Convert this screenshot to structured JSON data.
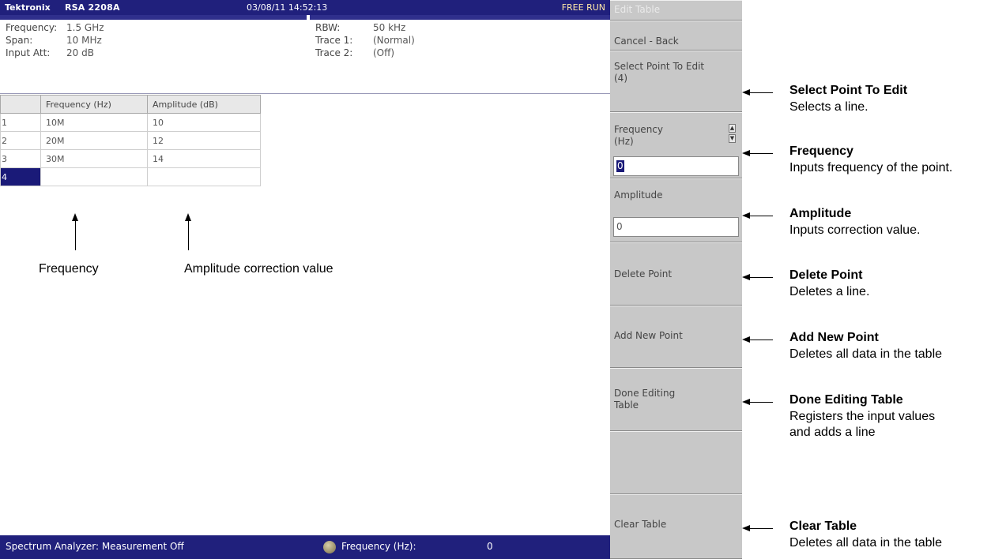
{
  "titlebar": {
    "brand": "Tektronix",
    "model": "RSA 2208A",
    "datetime": "03/08/11 14:52:13",
    "status": "FREE RUN"
  },
  "params": {
    "frequency_label": "Frequency:",
    "frequency_value": "1.5 GHz",
    "span_label": "Span:",
    "span_value": "10 MHz",
    "input_att_label": "Input Att:",
    "input_att_value": "20 dB",
    "rbw_label": "RBW:",
    "rbw_value": "50 kHz",
    "trace1_label": "Trace 1:",
    "trace1_value": "(Normal)",
    "trace2_label": "Trace 2:",
    "trace2_value": "(Off)"
  },
  "table": {
    "headers": [
      "",
      "Frequency (Hz)",
      "Amplitude (dB)"
    ],
    "rows": [
      {
        "index": "1",
        "frequency": "10M",
        "amplitude": "10"
      },
      {
        "index": "2",
        "frequency": "20M",
        "amplitude": "12"
      },
      {
        "index": "3",
        "frequency": "30M",
        "amplitude": "14"
      },
      {
        "index": "4",
        "frequency": "",
        "amplitude": ""
      }
    ]
  },
  "annotations": {
    "frequency": "Frequency",
    "amplitude": "Amplitude correction value"
  },
  "bottombar": {
    "mode": "Spectrum Analyzer: Measurement Off",
    "frequency_label": "Frequency (Hz):",
    "frequency_value": "0"
  },
  "menu": {
    "title": "Edit Table",
    "cancel_back": "Cancel - Back",
    "select_point": "Select Point To Edit",
    "select_point_count": "(4)",
    "frequency_label": "Frequency (Hz)",
    "frequency_value": "0",
    "amplitude_label": "Amplitude",
    "amplitude_value": "0",
    "delete_point": "Delete Point",
    "add_new_point": "Add New Point",
    "done_editing": "Done Editing Table",
    "clear_table": "Clear Table"
  },
  "callouts": {
    "select_title": "Select Point To Edit",
    "select_desc": "Selects a line.",
    "frequency_title": "Frequency",
    "frequency_desc": "Inputs frequency of the point.",
    "amplitude_title": "Amplitude",
    "amplitude_desc": "Inputs correction value.",
    "delete_title": "Delete Point",
    "delete_desc": "Deletes a line.",
    "add_title": "Add New Point",
    "add_desc": "Deletes all data in the table",
    "done_title": "Done Editing Table",
    "done_desc1": "Registers the input values",
    "done_desc2": "and adds a line",
    "clear_title": "Clear Table",
    "clear_desc": "Deletes all data in the table"
  },
  "colors": {
    "titlebar_bg": "#20207c",
    "menu_bg": "#c8c8c8",
    "selection": "#1a1a78",
    "status_text": "#ffe9a8"
  }
}
